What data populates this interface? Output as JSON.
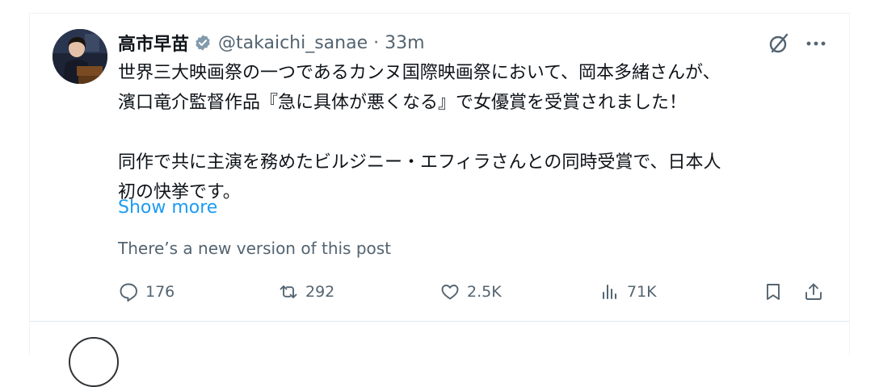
{
  "post": {
    "author_name": "高市早苗",
    "handle_time": "@takaichi_sanae · 33m",
    "lines_p1": [
      "世界三大映画祭の一つであるカンヌ国際映画祭において、岡本多緒さんが、",
      "濱口竜介監督作品『急に具体が悪くなる』で女優賞を受賞されました！"
    ],
    "lines_p2": [
      "同作で共に主演を務めたビルジニー・エフィラさんとの同時受賞で、日本人",
      "初の快挙です。"
    ],
    "show_more": "Show more",
    "new_version_notice": "There’s a new version of this post"
  },
  "actions": {
    "replies": "176",
    "reposts": "292",
    "likes": "2.5K",
    "views": "71K"
  },
  "icons": {
    "verified": "verified-badge-icon",
    "grok": "grok-icon",
    "more": "more-icon",
    "reply": "reply-icon",
    "repost": "repost-icon",
    "like": "heart-icon",
    "views": "views-icon",
    "bookmark": "bookmark-icon",
    "share": "share-icon"
  },
  "colors": {
    "text": "#0f1419",
    "secondary": "#536471",
    "link": "#1d9bf0",
    "verified_badge": "#829aab"
  }
}
